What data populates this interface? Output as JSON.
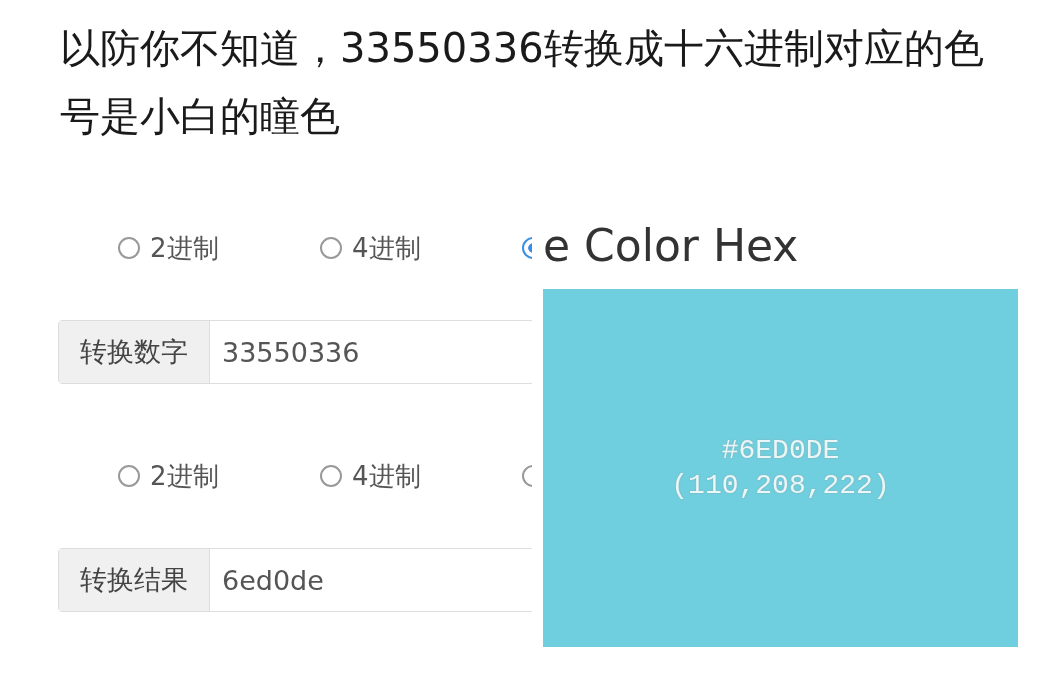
{
  "post_text": "以防你不知道，33550336转换成十六进制对应的色号是小白的瞳色",
  "left_screenshot": {
    "sections": [
      {
        "radios": [
          {
            "label": "2进制",
            "selected": false
          },
          {
            "label": "4进制",
            "selected": false
          },
          {
            "selected": true
          }
        ],
        "field": {
          "label": "转换数字",
          "value": "33550336"
        }
      },
      {
        "radios": [
          {
            "label": "2进制",
            "selected": false
          },
          {
            "label": "4进制",
            "selected": false
          },
          {
            "selected": false
          }
        ],
        "field": {
          "label": "转换结果",
          "value": "6ed0de"
        }
      }
    ]
  },
  "right_screenshot": {
    "title": "e Color Hex",
    "swatch": {
      "color": "#6fcfdf",
      "hex": "#6ED0DE",
      "rgb": "(110,208,222)"
    }
  }
}
